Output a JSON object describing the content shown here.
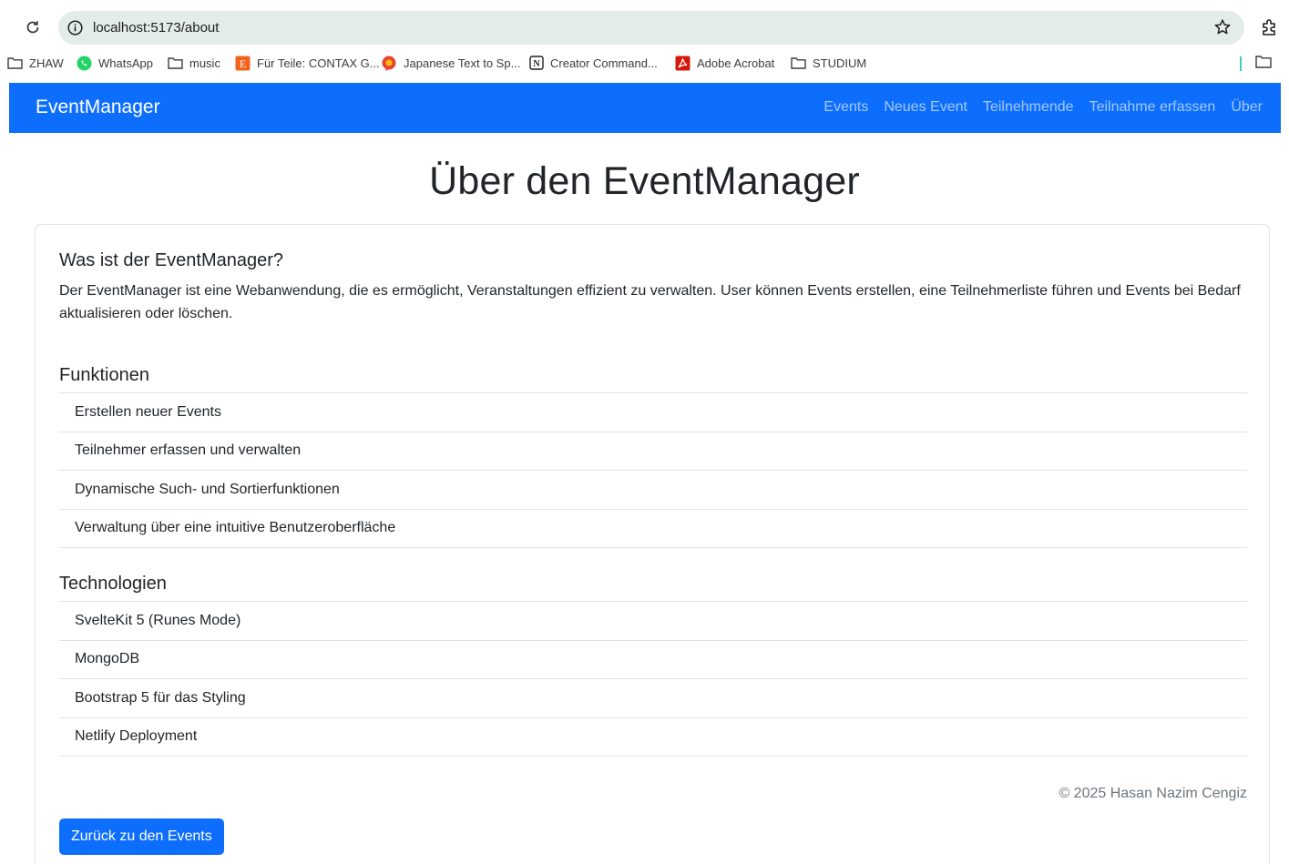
{
  "browser": {
    "url": "localhost:5173/about",
    "bookmarks": [
      {
        "label": "ZHAW",
        "icon": "folder-icon"
      },
      {
        "label": "WhatsApp",
        "icon": "whatsapp-icon"
      },
      {
        "label": "music",
        "icon": "folder-icon"
      },
      {
        "label": "Für Teile: CONTAX G...",
        "icon": "etsy-icon"
      },
      {
        "label": "Japanese Text to Sp...",
        "icon": "speech-bubble-icon"
      },
      {
        "label": "Creator Command...",
        "icon": "notion-icon"
      },
      {
        "label": "Adobe Acrobat",
        "icon": "acrobat-icon"
      },
      {
        "label": "STUDIUM",
        "icon": "folder-icon"
      }
    ]
  },
  "navbar": {
    "brand": "EventManager",
    "links": [
      "Events",
      "Neues Event",
      "Teilnehmende",
      "Teilnahme erfassen",
      "Über"
    ]
  },
  "page": {
    "title": "Über den EventManager",
    "what_heading": "Was ist der EventManager?",
    "intro": "Der EventManager ist eine Webanwendung, die es ermöglicht, Veranstaltungen effizient zu verwalten. User können Events erstellen, eine Teilnehmerliste führen und Events bei Bedarf aktualisieren oder löschen.",
    "features_heading": "Funktionen",
    "features": [
      "Erstellen neuer Events",
      "Teilnehmer erfassen und verwalten",
      "Dynamische Such- und Sortierfunktionen",
      "Verwaltung über eine intuitive Benutzeroberfläche"
    ],
    "tech_heading": "Technologien",
    "technologies": [
      "SvelteKit 5 (Runes Mode)",
      "MongoDB",
      "Bootstrap 5 für das Styling",
      "Netlify Deployment"
    ],
    "footer": "© 2025 Hasan Nazim Cengiz",
    "back_button": "Zurück zu den Events"
  },
  "colors": {
    "primary": "#0d6efd",
    "omnibox": "#e3ecea",
    "muted_text": "#6c757d"
  }
}
